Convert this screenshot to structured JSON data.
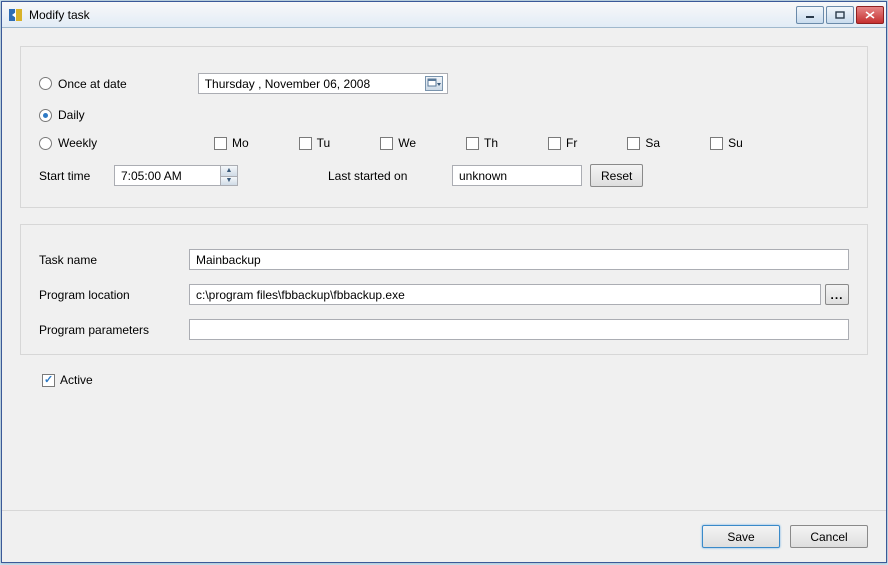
{
  "window": {
    "title": "Modify task"
  },
  "schedule": {
    "options": {
      "once": "Once at date",
      "daily": "Daily",
      "weekly": "Weekly"
    },
    "selected": "daily",
    "date_value": "Thursday  , November 06, 2008",
    "weekdays": {
      "mo": "Mo",
      "tu": "Tu",
      "we": "We",
      "th": "Th",
      "fr": "Fr",
      "sa": "Sa",
      "su": "Su"
    },
    "start_time_label": "Start time",
    "start_time_value": "7:05:00 AM",
    "last_started_label": "Last started on",
    "last_started_value": "unknown",
    "reset_label": "Reset"
  },
  "task": {
    "name_label": "Task name",
    "name_value": "Mainbackup",
    "location_label": "Program location",
    "location_value": "c:\\program files\\fbbackup\\fbbackup.exe",
    "params_label": "Program parameters",
    "params_value": "",
    "browse_label": "..."
  },
  "active": {
    "label": "Active",
    "checked": true
  },
  "buttons": {
    "save": "Save",
    "cancel": "Cancel"
  }
}
